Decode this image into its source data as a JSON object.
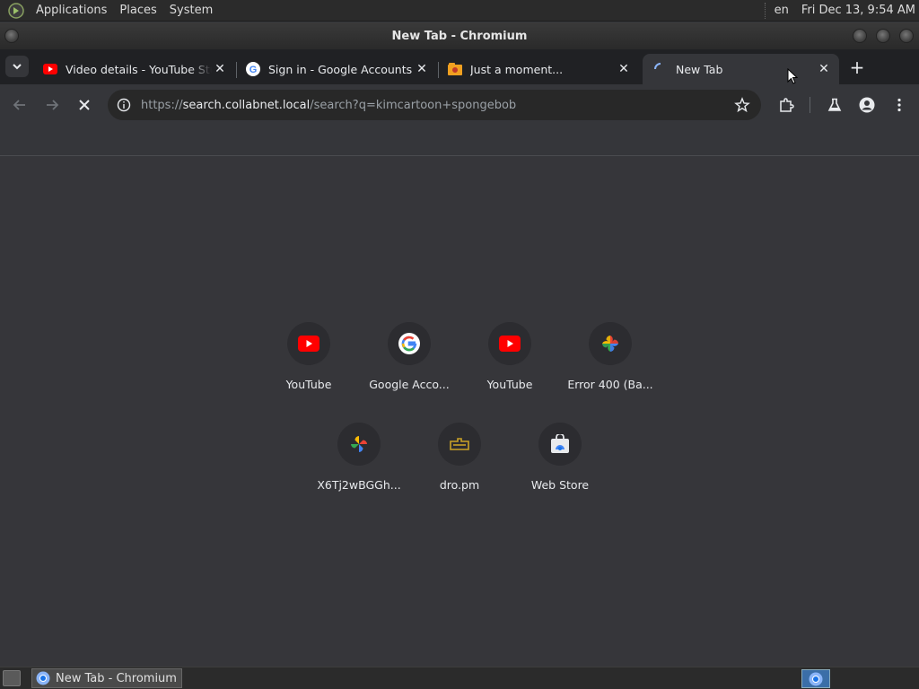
{
  "system_panel": {
    "menus": [
      "Applications",
      "Places",
      "System"
    ],
    "language": "en",
    "clock": "Fri Dec 13,  9:54 AM"
  },
  "window": {
    "title": "New Tab - Chromium"
  },
  "tabs": [
    {
      "label": "Video details - YouTube Studio",
      "favicon": "youtube-icon"
    },
    {
      "label": "Sign in - Google Accounts",
      "favicon": "google-icon"
    },
    {
      "label": "Just a moment...",
      "favicon": "folder-icon"
    },
    {
      "label": "New Tab",
      "favicon": "loading-spinner-icon",
      "active": true
    }
  ],
  "toolbar": {
    "url_scheme": "https://",
    "url_host": "search.collabnet.local",
    "url_path": "/search?q=kimcartoon+spongebob"
  },
  "shortcuts": [
    {
      "label": "YouTube",
      "icon": "youtube-icon"
    },
    {
      "label": "Google Acco...",
      "icon": "google-icon"
    },
    {
      "label": "YouTube",
      "icon": "youtube-icon"
    },
    {
      "label": "Error 400 (Ba...",
      "icon": "google-photos-icon"
    },
    {
      "label": "X6Tj2wBGGh...",
      "icon": "google-photos-icon"
    },
    {
      "label": "dro.pm",
      "icon": "dro-pm-icon"
    },
    {
      "label": "Web Store",
      "icon": "web-store-icon"
    }
  ],
  "taskbar": {
    "task_label": "New Tab - Chromium"
  },
  "colors": {
    "background": "#35363a",
    "youtube_red": "#ff0000",
    "text": "#e8eaed"
  }
}
